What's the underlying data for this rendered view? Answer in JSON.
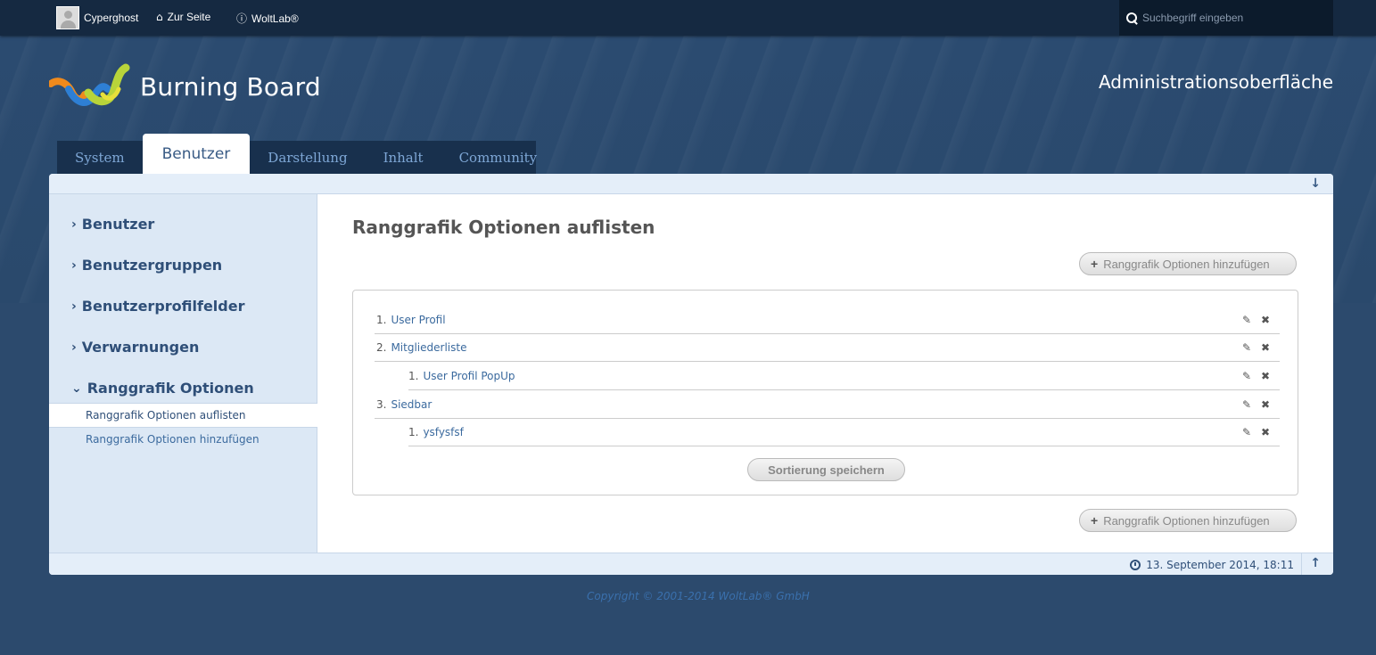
{
  "topbar": {
    "username": "Cyperghost",
    "home_label": "Zur Seite",
    "woltlab_label": "WoltLab®",
    "search_placeholder": "Suchbegriff eingeben"
  },
  "header": {
    "logo_text": "Burning Board",
    "admin_title": "Administrationsoberfläche"
  },
  "tabs": [
    {
      "label": "System",
      "active": false
    },
    {
      "label": "Benutzer",
      "active": true
    },
    {
      "label": "Darstellung",
      "active": false
    },
    {
      "label": "Inhalt",
      "active": false
    },
    {
      "label": "Community",
      "active": false
    }
  ],
  "sidebar": {
    "categories": [
      {
        "label": "Benutzer",
        "open": false
      },
      {
        "label": "Benutzergruppen",
        "open": false
      },
      {
        "label": "Benutzerprofilfelder",
        "open": false
      },
      {
        "label": "Verwarnungen",
        "open": false
      },
      {
        "label": "Ranggrafik Optionen",
        "open": true
      }
    ],
    "sub_items": [
      {
        "label": "Ranggrafik Optionen auflisten",
        "active": true
      },
      {
        "label": "Ranggrafik Optionen hinzufügen",
        "active": false
      }
    ]
  },
  "main": {
    "title": "Ranggrafik Optionen auflisten",
    "add_button_label": "Ranggrafik Optionen hinzufügen",
    "sort_button_label": "Sortierung speichern",
    "items": [
      {
        "num": "1.",
        "label": "User Profil",
        "level": 0
      },
      {
        "num": "2.",
        "label": "Mitgliederliste",
        "level": 0
      },
      {
        "num": "1.",
        "label": "User Profil PopUp",
        "level": 1
      },
      {
        "num": "3.",
        "label": "Siedbar",
        "level": 0
      },
      {
        "num": "1.",
        "label": "ysfysfsf",
        "level": 1
      }
    ]
  },
  "footer": {
    "timestamp": "13. September 2014, 18:11",
    "copyright": "Copyright © 2001-2014 WoltLab® GmbH"
  },
  "colors": {
    "background": "#2c4a6d",
    "topbar": "#152941",
    "accent": "#2f4f78",
    "link": "#3b6a9e"
  }
}
